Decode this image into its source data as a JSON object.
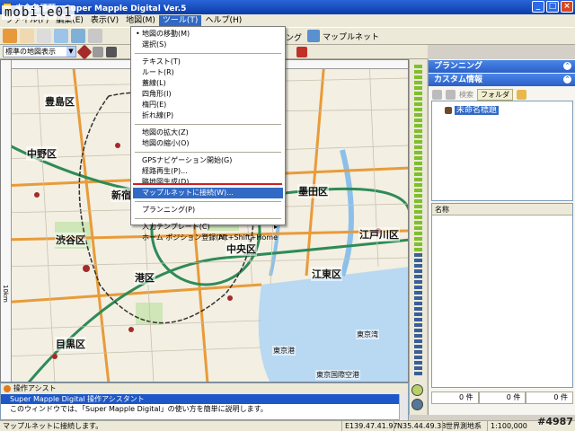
{
  "window": {
    "title": "未命名標題 - Super Mapple Digital Ver.5",
    "min_glyph": "_",
    "max_glyph": "□",
    "close_glyph": "×"
  },
  "watermark": "mobile01",
  "menubar": {
    "items": [
      {
        "label": "ファイル(F)"
      },
      {
        "label": "編集(E)"
      },
      {
        "label": "表示(V)"
      },
      {
        "label": "地図(M)"
      },
      {
        "label": "ツール(T)",
        "active": true
      },
      {
        "label": "ヘルプ(H)"
      }
    ]
  },
  "toolbar": {
    "net_label": "マップルネット",
    "partial_label": "ング",
    "map_type_combo": "標準の地図表示"
  },
  "tools_menu": {
    "items": [
      {
        "label": "地図の移動(M)",
        "bullet": "•"
      },
      {
        "label": "選択(S)"
      },
      {
        "sep": true
      },
      {
        "label": "テキスト(T)"
      },
      {
        "label": "ルート(R)"
      },
      {
        "label": "蓋線(L)"
      },
      {
        "label": "四角形(I)"
      },
      {
        "label": "楕円(E)"
      },
      {
        "label": "折れ線(P)"
      },
      {
        "sep": true
      },
      {
        "label": "地図の拡大(Z)"
      },
      {
        "label": "地図の縮小(O)"
      },
      {
        "sep": true
      },
      {
        "label": "GPSナビゲーション開始(G)"
      },
      {
        "label": "経路再生(P)..."
      },
      {
        "label": "略地図生成(D)..."
      },
      {
        "label": "マップルネットに接続(W)...",
        "selected": true
      },
      {
        "sep": true
      },
      {
        "label": "プランニング(P)"
      },
      {
        "sep": true
      },
      {
        "label": "入力テンプレート(C)",
        "submenu": "▸"
      },
      {
        "label": "ホーム ポジション登録(H)",
        "shortcut": "Alt+Shift+Home"
      }
    ]
  },
  "map": {
    "labels": [
      {
        "text": "豊島区",
        "cls": ""
      },
      {
        "text": "中野区",
        "cls": ""
      },
      {
        "text": "新宿",
        "cls": ""
      },
      {
        "text": "渋谷区",
        "cls": ""
      },
      {
        "text": "港区",
        "cls": ""
      },
      {
        "text": "目黒区",
        "cls": ""
      },
      {
        "text": "中央区",
        "cls": ""
      },
      {
        "text": "江東区",
        "cls": ""
      },
      {
        "text": "江戸川区",
        "cls": ""
      },
      {
        "text": "墨田区",
        "cls": ""
      },
      {
        "text": "東京港",
        "cls": "small"
      },
      {
        "text": "東京湾",
        "cls": "small"
      },
      {
        "text": "東京国際空港",
        "cls": "small"
      }
    ],
    "vertical_scale": "10km"
  },
  "right_panel": {
    "planning_title": "プランニング",
    "custom_title": "カスタム情報",
    "tools_text": "検索",
    "folder_button": "フォルダ",
    "tree_item": "未命名標題",
    "list_header": "名称",
    "counts": [
      "0 件",
      "0 件",
      "0 件"
    ]
  },
  "assist": {
    "title": "操作アシスト",
    "subtitle": "Super Mapple Digital 操作アシスタント",
    "body": "このウィンドウでは、「Super Mapple Digital」の使い方を簡単に説明します。"
  },
  "status": {
    "message": "マップルネットに接続します。",
    "lon": "E139.47.41.97",
    "lat": "N35.44.49.38",
    "datum": "世界測地系",
    "scale": "1:100,000"
  },
  "image_id": "#4987"
}
